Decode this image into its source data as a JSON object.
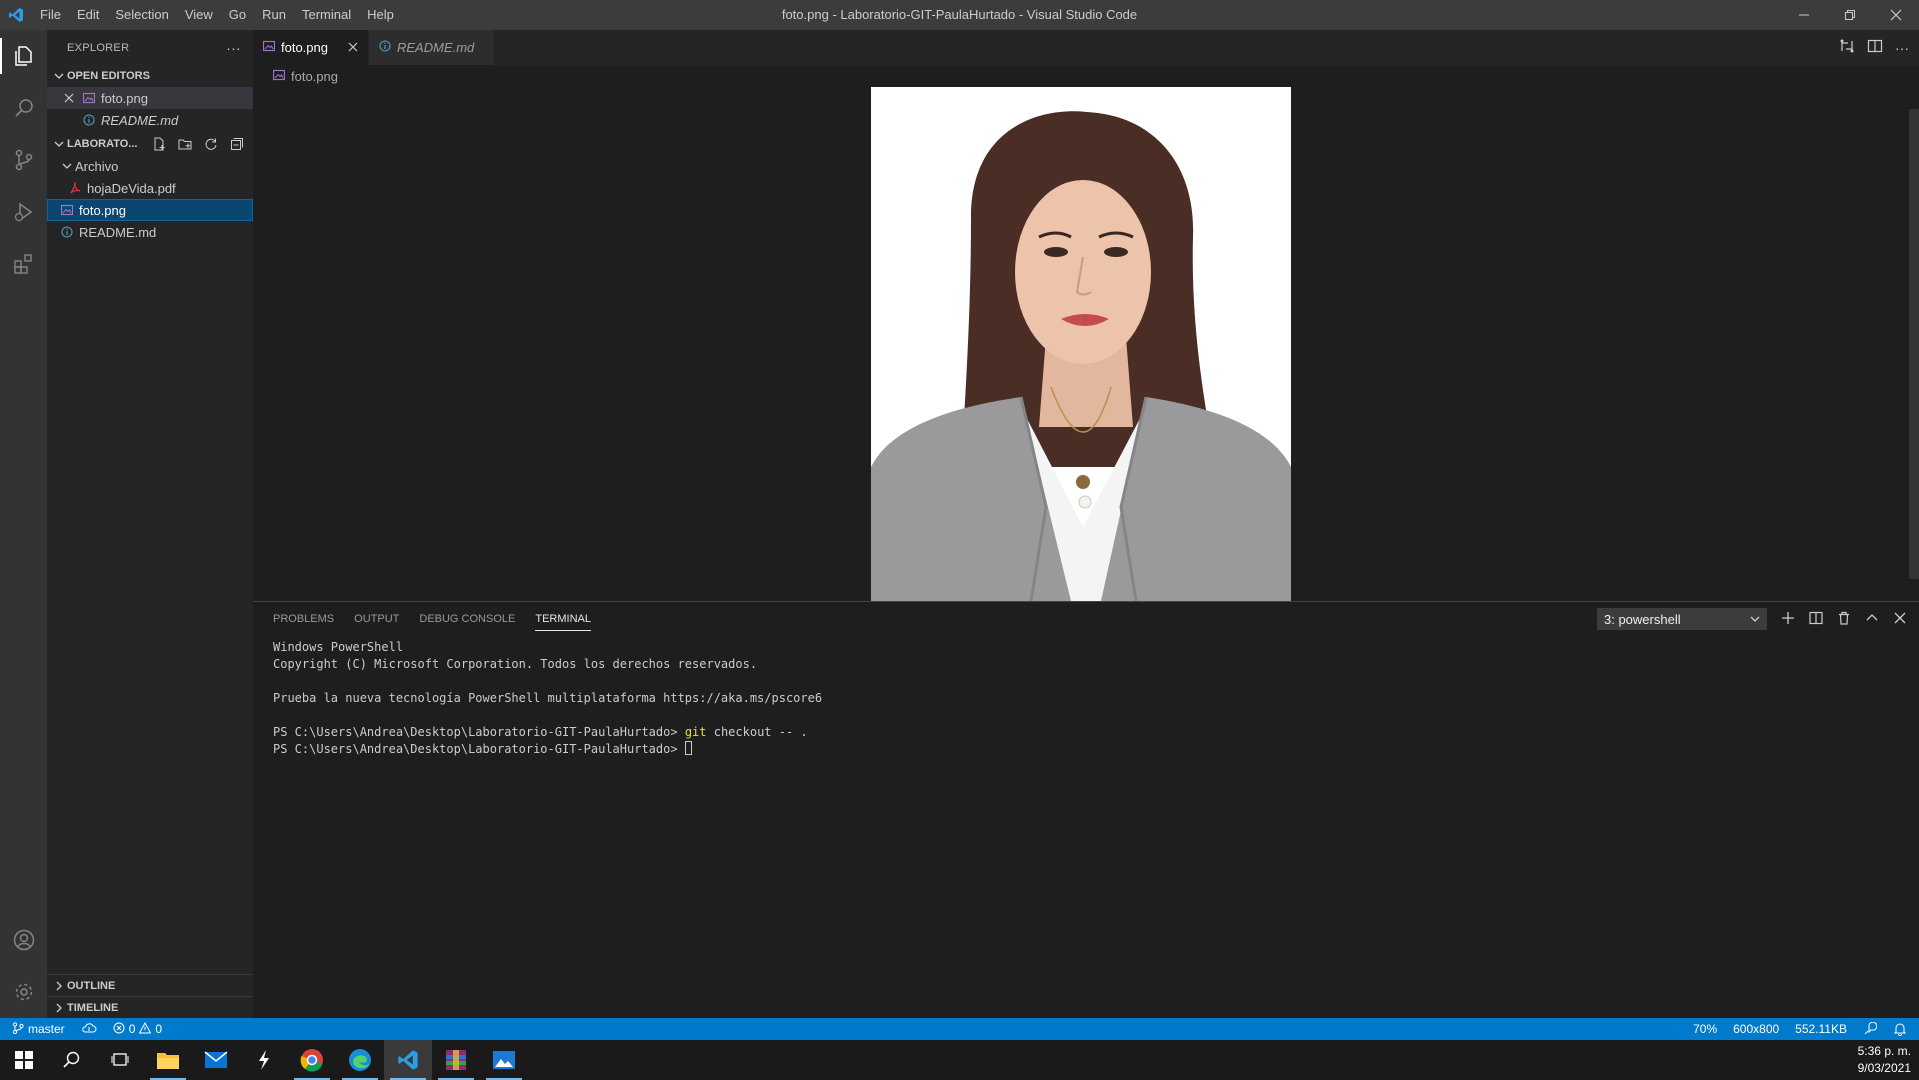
{
  "window": {
    "title": "foto.png - Laboratorio-GIT-PaulaHurtado - Visual Studio Code"
  },
  "menu": [
    "File",
    "Edit",
    "Selection",
    "View",
    "Go",
    "Run",
    "Terminal",
    "Help"
  ],
  "sidebar": {
    "title": "EXPLORER",
    "open_editors": {
      "label": "OPEN EDITORS",
      "items": [
        {
          "label": "foto.png"
        },
        {
          "label": "README.md"
        }
      ]
    },
    "folder": {
      "label": "LABORATO...",
      "items": [
        {
          "label": "Archivo"
        },
        {
          "label": "hojaDeVida.pdf"
        },
        {
          "label": "foto.png"
        },
        {
          "label": "README.md"
        }
      ]
    },
    "outline": "OUTLINE",
    "timeline": "TIMELINE"
  },
  "tabs": [
    {
      "label": "foto.png"
    },
    {
      "label": "README.md"
    }
  ],
  "breadcrumb": "foto.png",
  "panel": {
    "tabs": [
      "PROBLEMS",
      "OUTPUT",
      "DEBUG CONSOLE",
      "TERMINAL"
    ],
    "terminal_select": "3: powershell",
    "lines": {
      "l1": "Windows PowerShell",
      "l2": "Copyright (C) Microsoft Corporation. Todos los derechos reservados.",
      "l3": "Prueba la nueva tecnología PowerShell multiplataforma https://aka.ms/pscore6",
      "prompt": "PS C:\\Users\\Andrea\\Desktop\\Laboratorio-GIT-PaulaHurtado> ",
      "cmd_git": "git",
      "cmd_rest": " checkout -- ."
    }
  },
  "statusbar": {
    "branch": "master",
    "errors": "0",
    "warnings": "0",
    "zoom": "70%",
    "dimensions": "600x800",
    "size": "552.11KB"
  },
  "clock": {
    "time": "5:36 p. m.",
    "date": "9/03/2021"
  },
  "colors": {
    "accent": "#007acc",
    "selection": "#094771",
    "sidebar": "#252526",
    "editor": "#1e1e1e"
  }
}
